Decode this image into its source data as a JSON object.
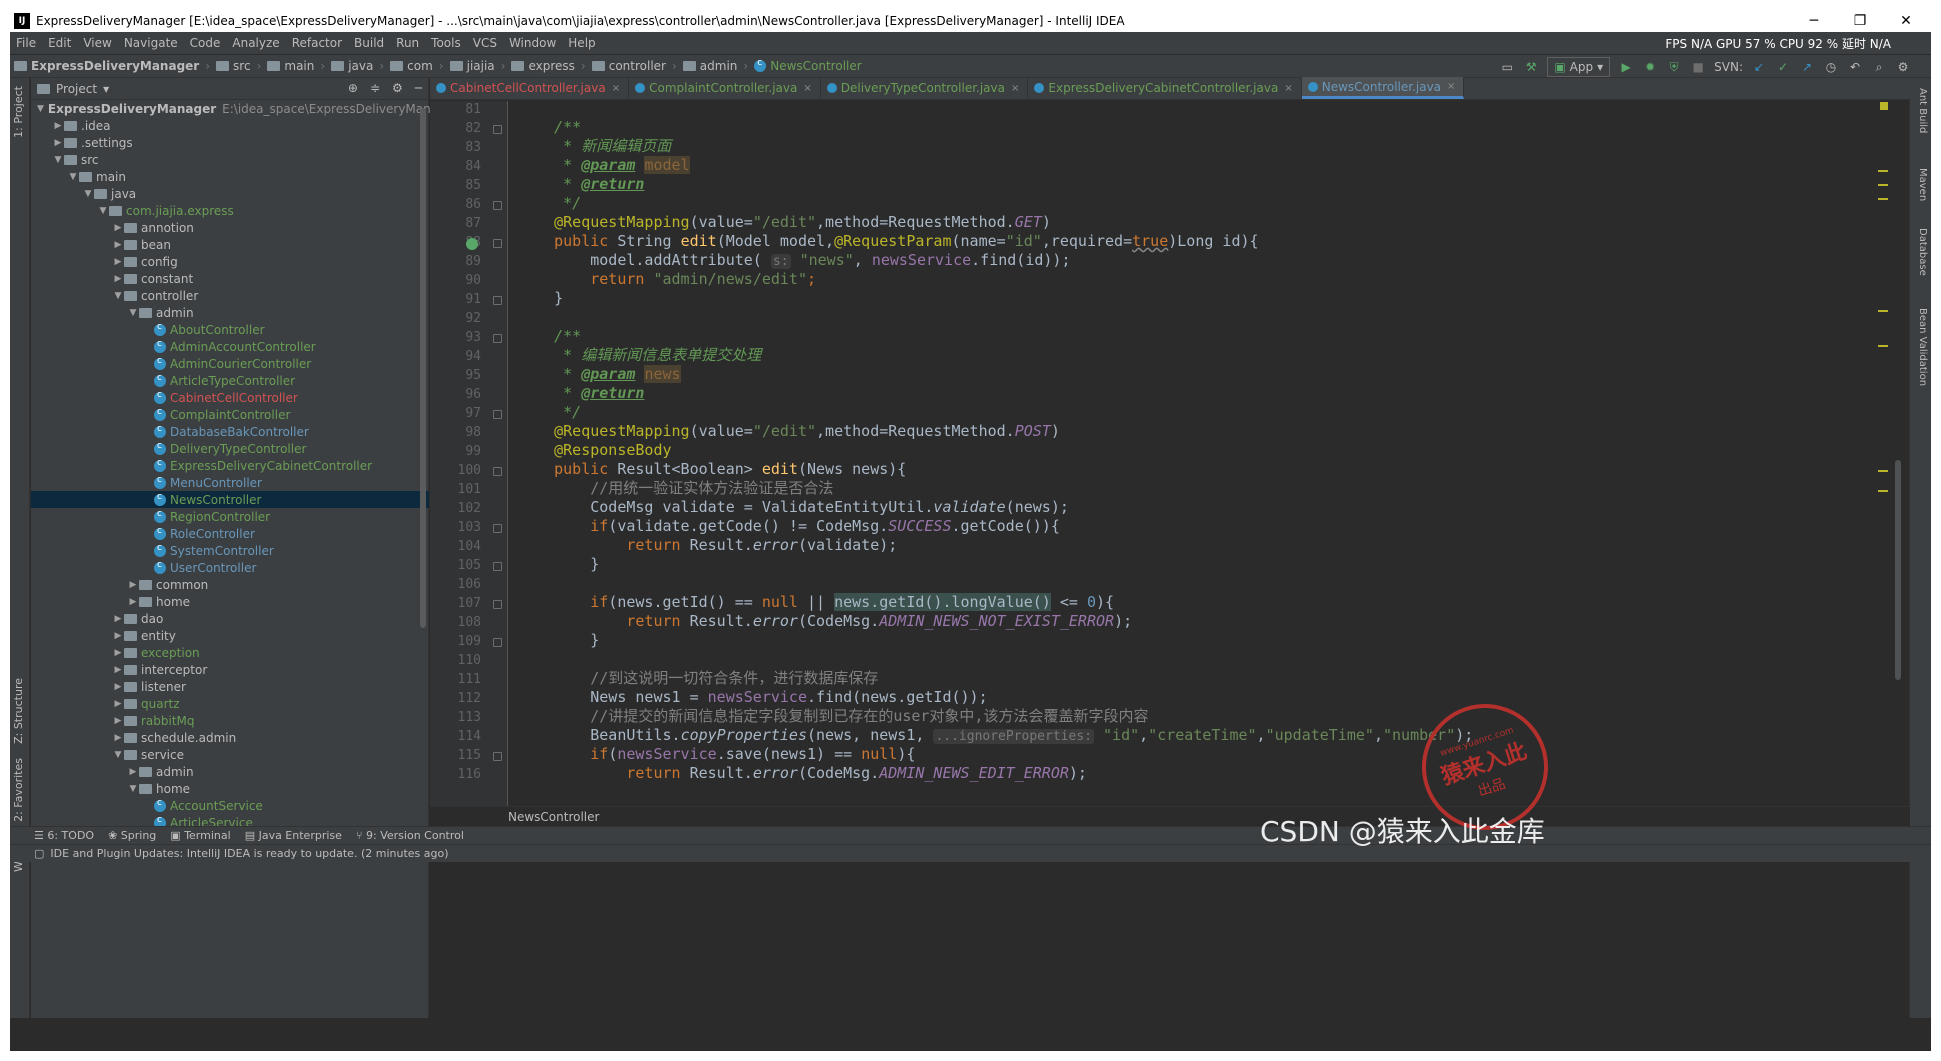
{
  "window": {
    "title": "ExpressDeliveryManager [E:\\idea_space\\ExpressDeliveryManager] - ...\\src\\main\\java\\com\\jiajia\\express\\controller\\admin\\NewsController.java [ExpressDeliveryManager] - IntelliJ IDEA",
    "minimize": "─",
    "maximize": "❐",
    "close": "✕"
  },
  "menu": {
    "items": [
      "File",
      "Edit",
      "View",
      "Navigate",
      "Code",
      "Analyze",
      "Refactor",
      "Build",
      "Run",
      "Tools",
      "VCS",
      "Window",
      "Help"
    ],
    "perf": "FPS N/A GPU 57 % CPU 92 % 延时 N/A"
  },
  "nav": {
    "crumbs": [
      "ExpressDeliveryManager",
      "src",
      "main",
      "java",
      "com",
      "jiajia",
      "express",
      "controller",
      "admin",
      "NewsController"
    ],
    "run_config": "App",
    "svn": "SVN:"
  },
  "side_tabs": {
    "project": "1: Project",
    "structure": "Z: Structure",
    "favorites": "2: Favorites",
    "web": "Web",
    "ant": "Ant Build",
    "maven": "Maven",
    "database": "Database",
    "bean": "Bean Validation"
  },
  "project_panel": {
    "title": "Project",
    "tree": [
      {
        "label": "ExpressDeliveryManager",
        "suffix": "E:\\idea_space\\ExpressDeliveryManager",
        "depth": 0,
        "open": true,
        "kind": "module",
        "color": "#bbbbbb",
        "bold": true
      },
      {
        "label": ".idea",
        "depth": 1,
        "open": false,
        "kind": "folder",
        "color": "#bbbbbb"
      },
      {
        "label": ".settings",
        "depth": 1,
        "open": false,
        "kind": "folder",
        "color": "#bbbbbb"
      },
      {
        "label": "src",
        "depth": 1,
        "open": true,
        "kind": "folder",
        "color": "#bbbbbb"
      },
      {
        "label": "main",
        "depth": 2,
        "open": true,
        "kind": "folder",
        "color": "#bbbbbb"
      },
      {
        "label": "java",
        "depth": 3,
        "open": true,
        "kind": "folder",
        "color": "#bbbbbb"
      },
      {
        "label": "com.jiajia.express",
        "depth": 4,
        "open": true,
        "kind": "folder",
        "color": "#6a9d55"
      },
      {
        "label": "annotion",
        "depth": 5,
        "open": false,
        "kind": "folder",
        "color": "#bbbbbb"
      },
      {
        "label": "bean",
        "depth": 5,
        "open": false,
        "kind": "folder",
        "color": "#bbbbbb"
      },
      {
        "label": "config",
        "depth": 5,
        "open": false,
        "kind": "folder",
        "color": "#bbbbbb"
      },
      {
        "label": "constant",
        "depth": 5,
        "open": false,
        "kind": "folder",
        "color": "#bbbbbb"
      },
      {
        "label": "controller",
        "depth": 5,
        "open": true,
        "kind": "folder",
        "color": "#bbbbbb"
      },
      {
        "label": "admin",
        "depth": 6,
        "open": true,
        "kind": "folder",
        "color": "#bbbbbb"
      },
      {
        "label": "AboutController",
        "depth": 7,
        "kind": "class",
        "color": "#6a9d55"
      },
      {
        "label": "AdminAccountController",
        "depth": 7,
        "kind": "class",
        "color": "#6a9d55"
      },
      {
        "label": "AdminCourierController",
        "depth": 7,
        "kind": "class",
        "color": "#6a9d55"
      },
      {
        "label": "ArticleTypeController",
        "depth": 7,
        "kind": "class",
        "color": "#6a9d55"
      },
      {
        "label": "CabinetCellController",
        "depth": 7,
        "kind": "class",
        "color": "#d25252"
      },
      {
        "label": "ComplaintController",
        "depth": 7,
        "kind": "class",
        "color": "#6a9d55"
      },
      {
        "label": "DatabaseBakController",
        "depth": 7,
        "kind": "class",
        "color": "#6897bb"
      },
      {
        "label": "DeliveryTypeController",
        "depth": 7,
        "kind": "class",
        "color": "#6a9d55"
      },
      {
        "label": "ExpressDeliveryCabinetController",
        "depth": 7,
        "kind": "class",
        "color": "#6a9d55"
      },
      {
        "label": "MenuController",
        "depth": 7,
        "kind": "class",
        "color": "#6897bb"
      },
      {
        "label": "NewsController",
        "depth": 7,
        "kind": "class",
        "color": "#6a9d55",
        "selected": true
      },
      {
        "label": "RegionController",
        "depth": 7,
        "kind": "class",
        "color": "#6a9d55"
      },
      {
        "label": "RoleController",
        "depth": 7,
        "kind": "class",
        "color": "#6897bb"
      },
      {
        "label": "SystemController",
        "depth": 7,
        "kind": "class",
        "color": "#6897bb"
      },
      {
        "label": "UserController",
        "depth": 7,
        "kind": "class",
        "color": "#6897bb"
      },
      {
        "label": "common",
        "depth": 6,
        "open": false,
        "kind": "folder",
        "color": "#bbbbbb"
      },
      {
        "label": "home",
        "depth": 6,
        "open": false,
        "kind": "folder",
        "color": "#bbbbbb"
      },
      {
        "label": "dao",
        "depth": 5,
        "open": false,
        "kind": "folder",
        "color": "#bbbbbb"
      },
      {
        "label": "entity",
        "depth": 5,
        "open": false,
        "kind": "folder",
        "color": "#bbbbbb"
      },
      {
        "label": "exception",
        "depth": 5,
        "open": false,
        "kind": "folder",
        "color": "#6a9d55"
      },
      {
        "label": "interceptor",
        "depth": 5,
        "open": false,
        "kind": "folder",
        "color": "#bbbbbb"
      },
      {
        "label": "listener",
        "depth": 5,
        "open": false,
        "kind": "folder",
        "color": "#bbbbbb"
      },
      {
        "label": "quartz",
        "depth": 5,
        "open": false,
        "kind": "folder",
        "color": "#6a9d55"
      },
      {
        "label": "rabbitMq",
        "depth": 5,
        "open": false,
        "kind": "folder",
        "color": "#6a9d55"
      },
      {
        "label": "schedule.admin",
        "depth": 5,
        "open": false,
        "kind": "folder",
        "color": "#bbbbbb"
      },
      {
        "label": "service",
        "depth": 5,
        "open": true,
        "kind": "folder",
        "color": "#bbbbbb"
      },
      {
        "label": "admin",
        "depth": 6,
        "open": false,
        "kind": "folder",
        "color": "#bbbbbb"
      },
      {
        "label": "home",
        "depth": 6,
        "open": true,
        "kind": "folder",
        "color": "#bbbbbb"
      },
      {
        "label": "AccountService",
        "depth": 7,
        "kind": "class",
        "color": "#6a9d55"
      },
      {
        "label": "ArticleService",
        "depth": 7,
        "kind": "class",
        "color": "#6a9d55"
      }
    ]
  },
  "tabs": [
    {
      "label": "CabinetCellController.java",
      "color": "#d25252",
      "active": false
    },
    {
      "label": "ComplaintController.java",
      "color": "#6a9d55",
      "active": false
    },
    {
      "label": "DeliveryTypeController.java",
      "color": "#6a9d55",
      "active": false
    },
    {
      "label": "ExpressDeliveryCabinetController.java",
      "color": "#6a9d55",
      "active": false
    },
    {
      "label": "NewsController.java",
      "color": "#6897bb",
      "active": true
    }
  ],
  "line_numbers": [
    "81",
    "82",
    "83",
    "84",
    "85",
    "86",
    "87",
    "88",
    "89",
    "90",
    "91",
    "92",
    "93",
    "94",
    "95",
    "96",
    "97",
    "98",
    "99",
    "100",
    "101",
    "102",
    "103",
    "104",
    "105",
    "106",
    "107",
    "108",
    "109",
    "110",
    "111",
    "112",
    "113",
    "114",
    "115",
    "116"
  ],
  "code": {
    "l82": "/**",
    "l83_star": "* ",
    "l83_text": "新闻编辑页面",
    "l84_tag": "@param",
    "l84_name": "model",
    "l85_tag": "@return",
    "l86": "*/",
    "l87_ann": "@RequestMapping",
    "l87_a": "(value=",
    "l87_str": "\"/edit\"",
    "l87_b": ",method=RequestMethod.",
    "l87_c": "GET",
    "l87_d": ")",
    "l88_kw": "public ",
    "l88_a": "String ",
    "l88_fn": "edit",
    "l88_b": "(Model model,",
    "l88_ann": "@RequestParam",
    "l88_c": "(name=",
    "l88_str": "\"id\"",
    "l88_d": ",required=",
    "l88_true": "true",
    "l88_e": ")Long id){",
    "l89_a": "model.addAttribute(",
    "l89_hint": "s:",
    "l89_str": "\"news\"",
    "l89_b": ", ",
    "l89_fld": "newsService",
    "l89_c": ".find(id));",
    "l90_kw": "return ",
    "l90_str": "\"admin/news/edit\"",
    "l90_end": ";",
    "l91": "}",
    "l93": "/**",
    "l94_text": "编辑新闻信息表单提交处理",
    "l95_tag": "@param",
    "l95_name": "news",
    "l96_tag": "@return",
    "l97": "*/",
    "l98_ann": "@RequestMapping",
    "l98_a": "(value=",
    "l98_str": "\"/edit\"",
    "l98_b": ",method=RequestMethod.",
    "l98_c": "POST",
    "l98_d": ")",
    "l99_ann": "@ResponseBody",
    "l100_kw": "public ",
    "l100_a": "Result<Boolean> ",
    "l100_fn": "edit",
    "l100_b": "(News news){",
    "l101": "//用统一验证实体方法验证是否合法",
    "l102_a": "CodeMsg validate = ValidateEntityUtil.",
    "l102_it": "validate",
    "l102_b": "(news);",
    "l103_kw": "if",
    "l103_a": "(validate.getCode() != CodeMsg.",
    "l103_fld": "SUCCESS",
    "l103_b": ".getCode()){",
    "l104_kw": "return ",
    "l104_a": "Result.",
    "l104_it": "error",
    "l104_b": "(validate);",
    "l105": "}",
    "l107_kw": "if",
    "l107_a": "(news.getId() == ",
    "l107_null": "null",
    "l107_b": " || ",
    "l107_hl": "news.getId().longValue()",
    "l107_c": " <= ",
    "l107_num": "0",
    "l107_d": "){",
    "l108_kw": "return ",
    "l108_a": "Result.",
    "l108_it": "error",
    "l108_b": "(CodeMsg.",
    "l108_fld": "ADMIN_NEWS_NOT_EXIST_ERROR",
    "l108_c": ");",
    "l109": "}",
    "l111": "//到这说明一切符合条件，进行数据库保存",
    "l112_a": "News news1 = ",
    "l112_fld": "newsService",
    "l112_b": ".find(news.getId());",
    "l113": "//讲提交的新闻信息指定字段复制到已存在的user对象中,该方法会覆盖新字段内容",
    "l114_a": "BeanUtils.",
    "l114_it": "copyProperties",
    "l114_b": "(news, news1, ",
    "l114_hint": "...ignoreProperties:",
    "l114_s1": "\"id\"",
    "l114_s2": "\"createTime\"",
    "l114_s3": "\"updateTime\"",
    "l114_s4": "\"number\"",
    "l114_c": ");",
    "l115_kw": "if",
    "l115_a": "(",
    "l115_fld": "newsService",
    "l115_b": ".save(news1) == ",
    "l115_null": "null",
    "l115_c": "){",
    "l116_kw": "return ",
    "l116_a": "Result.",
    "l116_it": "error",
    "l116_b": "(CodeMsg.",
    "l116_fld": "ADMIN_NEWS_EDIT_ERROR",
    "l116_c": ");"
  },
  "editor_breadcrumb": "NewsController",
  "bottom_tools": [
    "6: TODO",
    "Spring",
    "Terminal",
    "Java Enterprise",
    "9: Version Control"
  ],
  "status": "IDE and Plugin Updates: IntelliJ IDEA is ready to update. (2 minutes ago)",
  "watermark": "CSDN @猿来入此金库",
  "stamp": {
    "top": "www.yuanrc.com",
    "main": "猿来入此",
    "sub": "出品"
  }
}
